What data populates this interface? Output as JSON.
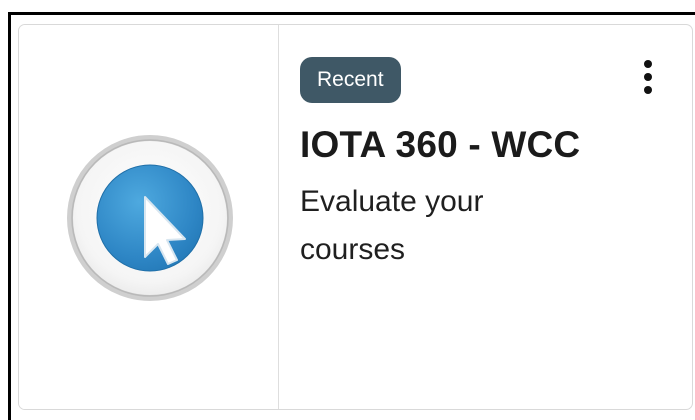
{
  "card": {
    "badge": "Recent",
    "title": "IOTA 360 - WCC",
    "description": "Evaluate your courses",
    "menu_icon": "kebab-menu-icon",
    "logo_icon": "cursor-circle-logo-icon"
  },
  "colors": {
    "badge_bg": "#3f5866",
    "badge_text": "#ffffff",
    "logo_ring": "#c9c9c9",
    "logo_fill": "#3a94cf",
    "logo_cursor": "#ffffff"
  }
}
